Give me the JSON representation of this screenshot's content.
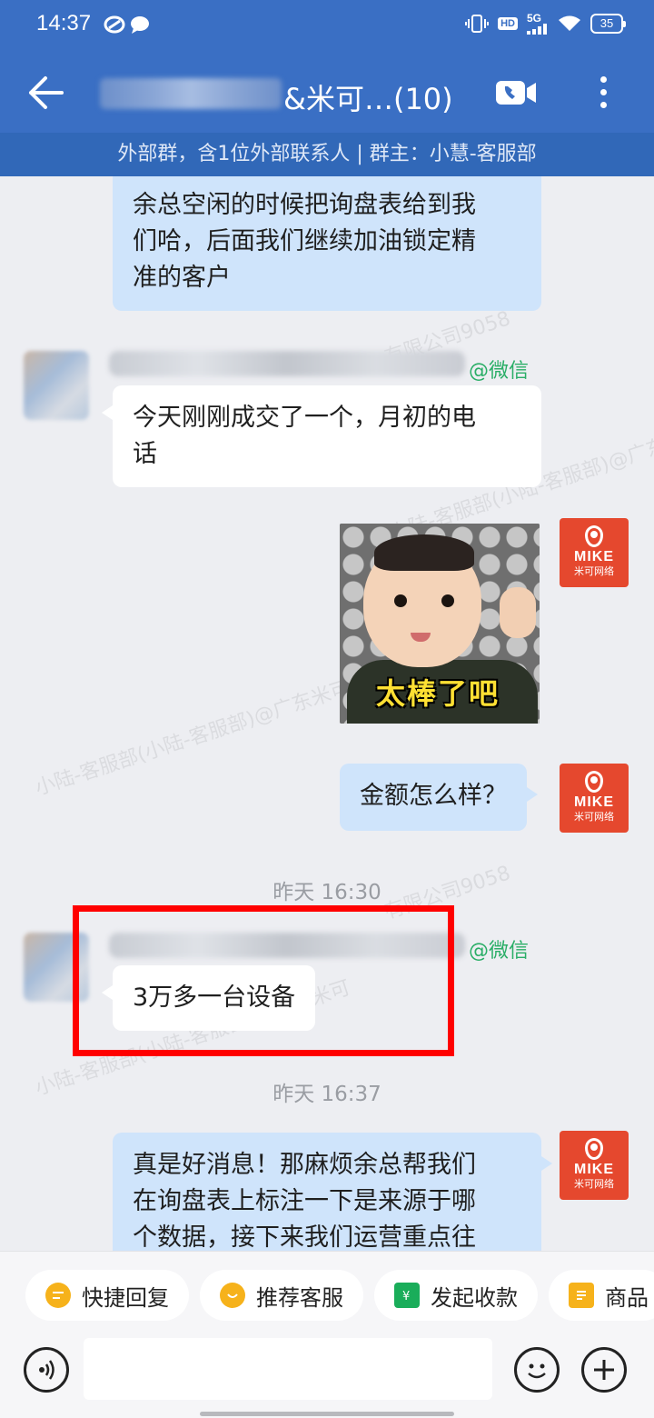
{
  "status_bar": {
    "time": "14:37",
    "hd_label": "HD",
    "network_label": "5G",
    "battery": "35",
    "icons": [
      "notification-app-icon",
      "message-icon",
      "vibrate-icon",
      "hd-icon",
      "signal-icon",
      "wifi-icon",
      "battery-icon"
    ]
  },
  "header": {
    "title": "&米可…(10)",
    "subtitle": "外部群，含1位外部联系人 | 群主：小慧-客服部"
  },
  "watermark": {
    "lines": [
      "小陆-客服部(小陆-客服部)@广东米可",
      "有限公司9058"
    ]
  },
  "messages": [
    {
      "id": "m1",
      "side": "right",
      "type": "text",
      "text": "余总空闲的时候把询盘表给到我们哈，后面我们继续加油锁定精准的客户",
      "lines": [
        "余总空闲的时候把询盘表给到我",
        "们哈，后面我们继续加油锁定精",
        "准的客户"
      ]
    },
    {
      "id": "m2",
      "side": "left",
      "type": "text",
      "source_tag": "@微信",
      "lines": [
        "今天刚刚成交了一个，月初的电",
        "话"
      ]
    },
    {
      "id": "m3",
      "side": "right",
      "type": "sticker",
      "sticker_text": "太棒了吧"
    },
    {
      "id": "m4",
      "side": "right",
      "type": "text",
      "lines": [
        "金额怎么样？"
      ]
    },
    {
      "id": "t1",
      "type": "timestamp",
      "text": "昨天 16:30"
    },
    {
      "id": "m5",
      "side": "left",
      "type": "text",
      "source_tag": "@微信",
      "lines": [
        "3万多一台设备"
      ],
      "highlighted": true
    },
    {
      "id": "t2",
      "type": "timestamp",
      "text": "昨天 16:37"
    },
    {
      "id": "m6",
      "side": "right",
      "type": "text",
      "lines": [
        "真是好消息！那麻烦余总帮我们",
        "在询盘表上标注一下是来源于哪",
        "个数据，接下来我们运营重点往"
      ]
    }
  ],
  "brand_avatar": {
    "name": "MIKE",
    "subname": "米可网络",
    "color": "#e5482e"
  },
  "quick_actions": [
    {
      "label": "快捷回复",
      "icon": "quick-reply-icon",
      "color": "#f6b21b"
    },
    {
      "label": "推荐客服",
      "icon": "recommend-service-icon",
      "color": "#f6b21b"
    },
    {
      "label": "发起收款",
      "icon": "payment-icon",
      "color": "#1aad5a"
    },
    {
      "label": "商品",
      "icon": "product-icon",
      "color": "#f6b21b"
    }
  ],
  "colors": {
    "header_bg": "#3a6fc4",
    "outgoing_bubble": "#cfe4fb",
    "incoming_bubble": "#ffffff",
    "chat_bg": "#edeef2",
    "wechat_tag": "#2aae67",
    "highlight_box": "#ff0000"
  }
}
